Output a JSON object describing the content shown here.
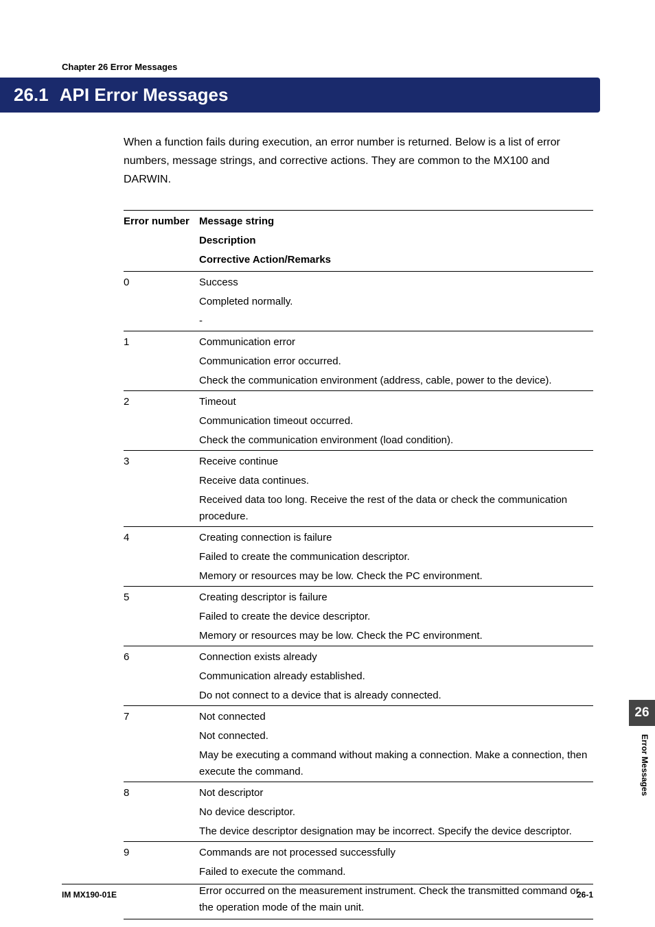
{
  "chapter_header": "Chapter 26 Error Messages",
  "section_number": "26.1",
  "section_title": "API Error Messages",
  "intro": "When a function fails during execution, an error number is returned. Below is a list of error numbers, message strings, and corrective actions. They are common to the MX100 and DARWIN.",
  "table_headers": {
    "col1": "Error number",
    "col2_line1": "Message string",
    "col2_line2": "Description",
    "col2_line3": "Corrective Action/Remarks"
  },
  "errors": [
    {
      "num": "0",
      "msg": "Success",
      "desc": "Completed normally.",
      "action": "-"
    },
    {
      "num": "1",
      "msg": "Communication error",
      "desc": "Communication error occurred.",
      "action": "Check the communication environment (address, cable, power to the device)."
    },
    {
      "num": "2",
      "msg": "Timeout",
      "desc": "Communication timeout occurred.",
      "action": "Check the communication environment (load condition)."
    },
    {
      "num": "3",
      "msg": "Receive continue",
      "desc": "Receive data continues.",
      "action": "Received data too long. Receive the rest of the data or check the communication procedure."
    },
    {
      "num": "4",
      "msg": "Creating connection is failure",
      "desc": "Failed to create the communication descriptor.",
      "action": "Memory or resources may be low. Check the PC environment."
    },
    {
      "num": "5",
      "msg": "Creating descriptor is failure",
      "desc": "Failed to create the device descriptor.",
      "action": "Memory or resources may be low. Check the PC environment."
    },
    {
      "num": "6",
      "msg": "Connection exists already",
      "desc": "Communication already established.",
      "action": "Do not connect to a device that is already connected."
    },
    {
      "num": "7",
      "msg": "Not connected",
      "desc": "Not connected.",
      "action": "May be executing a command without making a connection. Make a connection, then execute the command."
    },
    {
      "num": "8",
      "msg": "Not descriptor",
      "desc": "No device descriptor.",
      "action": "The device descriptor designation may be incorrect. Specify the device descriptor."
    },
    {
      "num": "9",
      "msg": "Commands are not processed successfully",
      "desc": "Failed to execute the command.",
      "action": "Error occurred on the measurement instrument. Check the transmitted command or the operation mode of the main unit."
    }
  ],
  "side_tab": "26",
  "side_label": "Error Messages",
  "footer_left": "IM MX190-01E",
  "footer_right": "26-1"
}
